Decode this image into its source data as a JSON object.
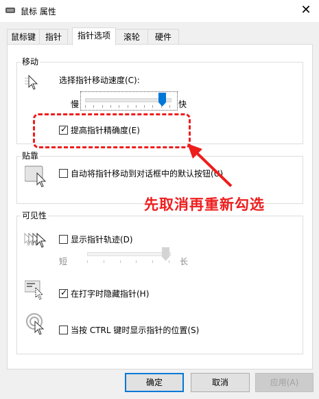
{
  "window": {
    "title": "鼠标 属性",
    "close_icon": "close-icon"
  },
  "tabs": [
    {
      "label": "鼠标键"
    },
    {
      "label": "指针"
    },
    {
      "label": "指针选项"
    },
    {
      "label": "滚轮"
    },
    {
      "label": "硬件"
    }
  ],
  "motion": {
    "legend": "移动",
    "speed_label": "选择指针移动速度(C):",
    "slow_label": "慢",
    "fast_label": "快",
    "speed_level": 0.95,
    "precision_label": "提高指针精确度(E)",
    "precision_checked": true
  },
  "snap": {
    "legend": "贴靠",
    "snap_label": "自动将指针移动到对话框中的默认按钮(U)",
    "snap_checked": false
  },
  "visibility": {
    "legend": "可见性",
    "trails_label": "显示指针轨迹(D)",
    "trails_checked": false,
    "short_label": "短",
    "long_label": "长",
    "trail_level": 1.0,
    "hide_label": "在打字时隐藏指针(H)",
    "hide_checked": true,
    "ctrl_label": "当按 CTRL 键时显示指针的位置(S)",
    "ctrl_checked": false
  },
  "buttons": {
    "ok": "确定",
    "cancel": "取消",
    "apply": "应用(A)"
  },
  "annotation": {
    "text": "先取消再重新勾选",
    "color": "#ee1d1d"
  },
  "colors": {
    "accent": "#0078d7",
    "annotation": "#ee1d1d"
  }
}
